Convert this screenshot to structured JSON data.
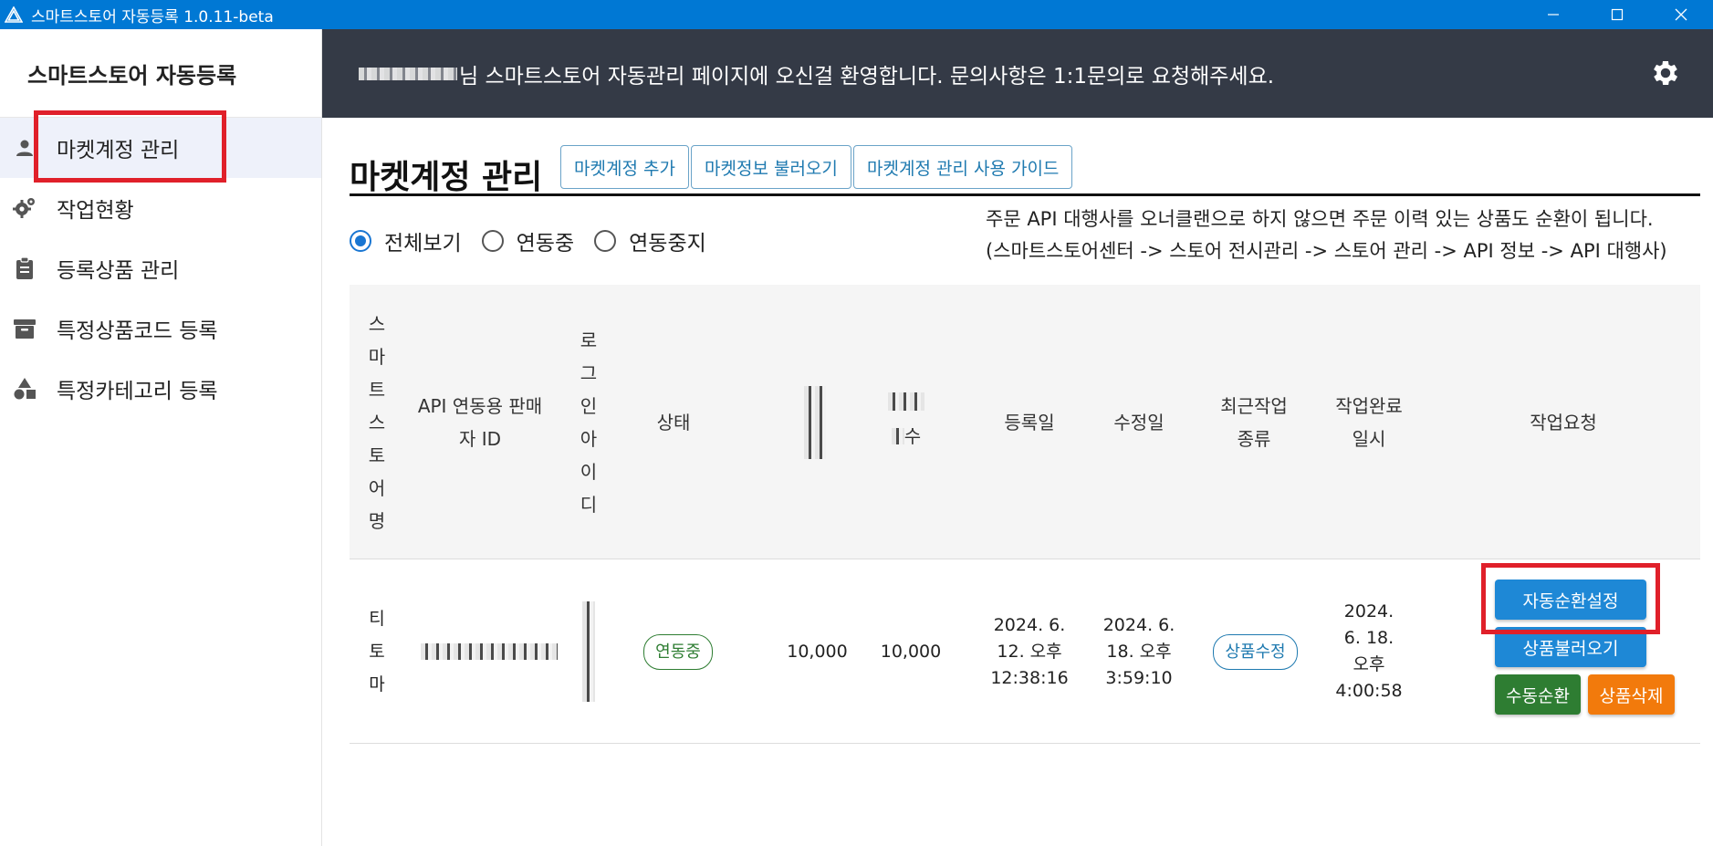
{
  "window": {
    "title": "스마트스토어 자동등록 1.0.11-beta"
  },
  "sidebar": {
    "brand": "스마트스토어 자동등록",
    "items": [
      {
        "label": "마켓계정 관리",
        "icon": "person-icon"
      },
      {
        "label": "작업현황",
        "icon": "gears-icon"
      },
      {
        "label": "등록상품 관리",
        "icon": "clipboard-icon"
      },
      {
        "label": "특정상품코드 등록",
        "icon": "archive-box-icon"
      },
      {
        "label": "특정카테고리 등록",
        "icon": "shapes-icon"
      }
    ]
  },
  "header": {
    "welcome": "님 스마트스토어 자동관리 페이지에 오신걸 환영합니다. 문의사항은 1:1문의로 요청해주세요."
  },
  "page": {
    "title": "마켓계정 관리",
    "buttons": {
      "add_account": "마켓계정 추가",
      "load_market_info": "마켓정보 불러오기",
      "guide": "마켓계정 관리 사용 가이드"
    },
    "filters": {
      "all": "전체보기",
      "linked": "연동중",
      "stopped": "연동중지"
    },
    "notice": {
      "line1": "주문 API 대행사를 오너클랜으로 하지 않으면 주문 이력 있는 상품도 순환이 됩니다.",
      "line2": "(스마트스토어센터 -> 스토어 전시관리 -> 스토어 관리 -> API 정보 -> API 대행사)"
    }
  },
  "table": {
    "headers": {
      "store_name": "스마트스토어명",
      "api_seller_id": "API 연동용 판매자 ID",
      "login_id": "로그인아이디",
      "status": "상태",
      "col5_partial": "수",
      "registered": "등록일",
      "modified": "수정일",
      "recent_job": "최근작업 종류",
      "job_done": "작업완료일시",
      "job_request": "작업요청"
    },
    "row": {
      "store_name": "티토마",
      "status": "연동중",
      "value1": "10,000",
      "value2": "10,000",
      "registered": "2024. 6. 12. 오후 12:38:16",
      "modified": "2024. 6. 18. 오후 3:59:10",
      "recent_job": "상품수정",
      "job_done": "2024. 6. 18. 오후 4:00:58"
    },
    "actions": {
      "auto_cycle": "자동순환설정",
      "load_products": "상품불러오기",
      "manual_cycle": "수동순환",
      "delete_products": "상품삭제"
    }
  },
  "colors": {
    "titlebar": "#0078d4",
    "header": "#343a46",
    "highlight": "#e0202a",
    "primary": "#1e88d6",
    "success": "#2e7d32",
    "warning": "#f27a0c"
  }
}
